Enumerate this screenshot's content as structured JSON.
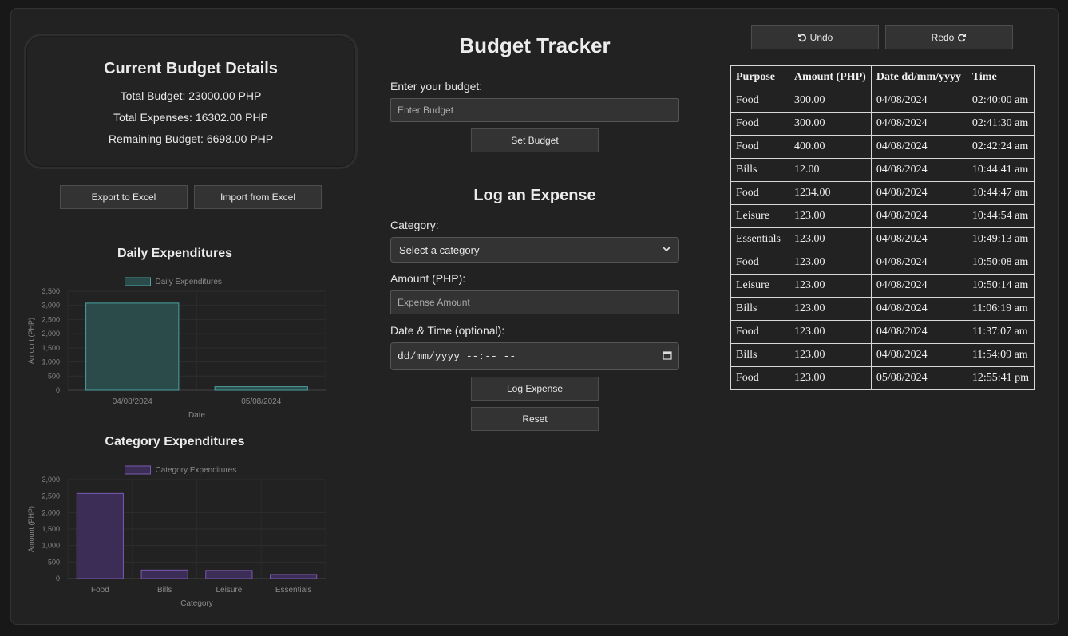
{
  "details": {
    "title": "Current Budget Details",
    "total_budget": "Total Budget: 23000.00 PHP",
    "total_expenses": "Total Expenses: 16302.00 PHP",
    "remaining_budget": "Remaining Budget: 6698.00 PHP"
  },
  "buttons": {
    "export": "Export to Excel",
    "import": "Import from Excel",
    "undo": "Undo",
    "redo": "Redo",
    "set_budget": "Set Budget",
    "log_expense": "Log Expense",
    "reset": "Reset"
  },
  "icons": {
    "undo": "undo-icon",
    "redo": "redo-icon",
    "chevron": "chevron-down-icon",
    "calendar": "calendar-icon"
  },
  "title": "Budget Tracker",
  "budget_form": {
    "label": "Enter your budget:",
    "placeholder": "Enter Budget"
  },
  "expense_form": {
    "title": "Log an Expense",
    "category_label": "Category:",
    "category_selected": "Select a category",
    "amount_label": "Amount (PHP):",
    "amount_placeholder": "Expense Amount",
    "datetime_label": "Date & Time (optional):",
    "datetime_value": "dd/mm/yyyy --:-- --"
  },
  "table": {
    "headers": [
      "Purpose",
      "Amount (PHP)",
      "Date dd/mm/yyyy",
      "Time"
    ],
    "rows": [
      [
        "Food",
        "300.00",
        "04/08/2024",
        "02:40:00 am"
      ],
      [
        "Food",
        "300.00",
        "04/08/2024",
        "02:41:30 am"
      ],
      [
        "Food",
        "400.00",
        "04/08/2024",
        "02:42:24 am"
      ],
      [
        "Bills",
        "12.00",
        "04/08/2024",
        "10:44:41 am"
      ],
      [
        "Food",
        "1234.00",
        "04/08/2024",
        "10:44:47 am"
      ],
      [
        "Leisure",
        "123.00",
        "04/08/2024",
        "10:44:54 am"
      ],
      [
        "Essentials",
        "123.00",
        "04/08/2024",
        "10:49:13 am"
      ],
      [
        "Food",
        "123.00",
        "04/08/2024",
        "10:50:08 am"
      ],
      [
        "Leisure",
        "123.00",
        "04/08/2024",
        "10:50:14 am"
      ],
      [
        "Bills",
        "123.00",
        "04/08/2024",
        "11:06:19 am"
      ],
      [
        "Food",
        "123.00",
        "04/08/2024",
        "11:37:07 am"
      ],
      [
        "Bills",
        "123.00",
        "04/08/2024",
        "11:54:09 am"
      ],
      [
        "Food",
        "123.00",
        "05/08/2024",
        "12:55:41 pm"
      ]
    ]
  },
  "colors": {
    "daily_fill": "#2b4b4b",
    "daily_stroke": "#4aa3a0",
    "category_fill": "#3b2d55",
    "category_stroke": "#7a5ab0"
  },
  "chart_data": [
    {
      "type": "bar",
      "title": "Daily Expenditures",
      "legend": "Daily Expenditures",
      "categories": [
        "04/08/2024",
        "05/08/2024"
      ],
      "values": [
        3080,
        123
      ],
      "xlabel": "Date",
      "ylabel": "Amount (PHP)",
      "ylim": [
        0,
        3500
      ],
      "yticks": [
        "0",
        "500",
        "1,000",
        "1,500",
        "2,000",
        "2,500",
        "3,000",
        "3,500"
      ],
      "legend_position": "top-center",
      "grid": true
    },
    {
      "type": "bar",
      "title": "Category Expenditures",
      "legend": "Category Expenditures",
      "categories": [
        "Food",
        "Bills",
        "Leisure",
        "Essentials"
      ],
      "values": [
        2580,
        258,
        246,
        123
      ],
      "xlabel": "Category",
      "ylabel": "Amount (PHP)",
      "ylim": [
        0,
        3000
      ],
      "yticks": [
        "0",
        "500",
        "1,000",
        "1,500",
        "2,000",
        "2,500",
        "3,000"
      ],
      "legend_position": "top-center",
      "grid": true
    }
  ]
}
